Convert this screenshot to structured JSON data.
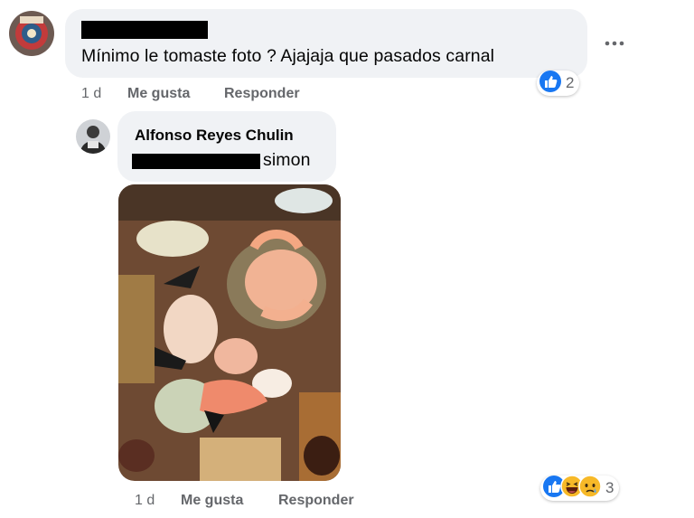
{
  "comment1": {
    "text": "Mínimo le tomaste foto ? Ajajaja que pasados carnal",
    "time": "1 d",
    "like_label": "Me gusta",
    "reply_label": "Responder",
    "reaction_count": "2",
    "reactions": [
      "like-icon"
    ]
  },
  "reply1": {
    "author": "Alfonso Reyes Chulin",
    "text": "simon",
    "time": "1 d",
    "like_label": "Me gusta",
    "reply_label": "Responder",
    "reaction_count": "3",
    "reactions": [
      "like-icon",
      "haha-icon",
      "sad-icon"
    ]
  },
  "colors": {
    "bubble": "#f0f2f5",
    "secondary_text": "#65676b",
    "like_blue": "#1877f2",
    "haha_yellow": "#f7b928"
  }
}
